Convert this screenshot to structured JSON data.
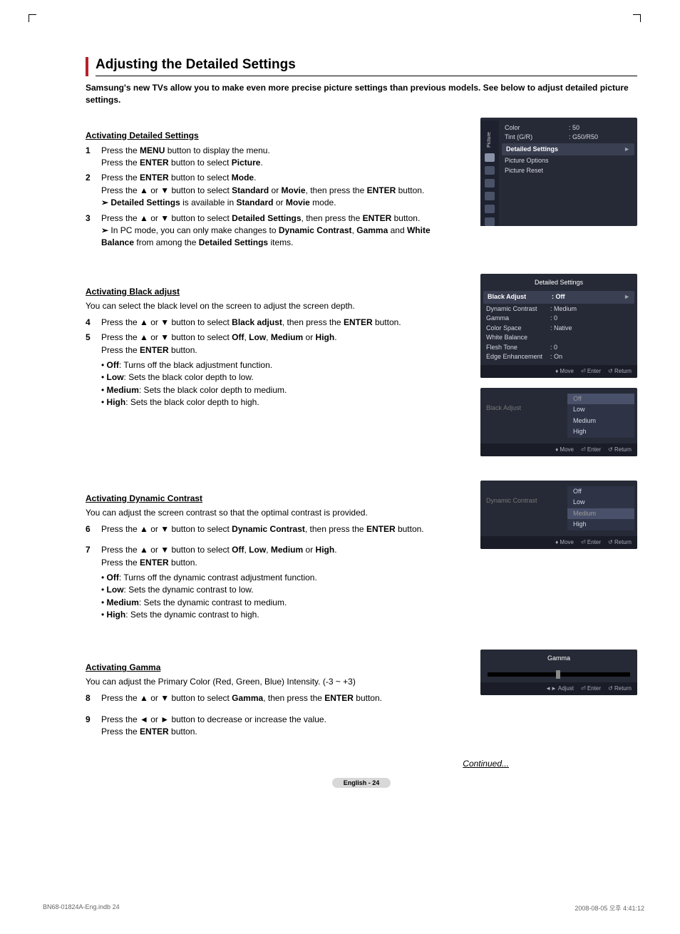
{
  "page": {
    "title": "Adjusting the Detailed Settings",
    "intro": "Samsung's new TVs allow you to make even more precise picture settings than previous models. See below to adjust detailed picture settings.",
    "continued": "Continued...",
    "footer_label": "English - 24",
    "footer_left": "BN68-01824A-Eng.indb   24",
    "footer_right": "2008-08-05   오후 4:41:12"
  },
  "s1": {
    "heading": "Activating Detailed Settings",
    "step1a": "Press the ",
    "step1a_btn": "MENU",
    "step1a_end": " button to display the menu.",
    "step1b": "Press the ",
    "step1b_btn": "ENTER",
    "step1b_end": " button to select ",
    "step1b_item": "Picture",
    "step2a": "Press the ",
    "step2a_btn": "ENTER",
    "step2a_end": " button to select ",
    "step2a_item": "Mode",
    "step2b": "Press the ▲ or ▼ button to select ",
    "step2b_i1": "Standard",
    "step2b_or": " or ",
    "step2b_i2": "Movie",
    "step2b_end": ", then press the ",
    "step2b_btn": "ENTER",
    "step2b_tail": " button.",
    "note2_pre": "Detailed Settings",
    "note2_mid": " is available in ",
    "note2_i1": "Standard",
    "note2_or": " or ",
    "note2_i2": "Movie",
    "note2_end": " mode.",
    "step3a": "Press the ▲ or ▼ button to select ",
    "step3a_item": "Detailed Settings",
    "step3a_end": ", then press the ",
    "step3a_btn": "ENTER",
    "step3a_tail": " button.",
    "note3_pre": "In PC mode, you can only make changes to ",
    "note3_i1": "Dynamic Contrast",
    "note3_c1": ", ",
    "note3_i2": "Gamma",
    "note3_and": " and ",
    "note3_i3": "White Balance",
    "note3_mid": " from among the ",
    "note3_i4": "Detailed Settings",
    "note3_end": " items."
  },
  "osd1": {
    "tab": "Picture",
    "color_l": "Color",
    "color_v": ": 50",
    "tint_l": "Tint (G/R)",
    "tint_v": ": G50/R50",
    "detailed": "Detailed Settings",
    "picopt": "Picture Options",
    "picreset": "Picture Reset"
  },
  "s2": {
    "heading": "Activating Black adjust",
    "desc": "You can select the black level on the screen to adjust the screen depth.",
    "step4": "Press the ▲ or ▼ button to select ",
    "step4_item": "Black adjust",
    "step4_end": ", then press the ",
    "step4_btn": "ENTER",
    "step4_tail": " button.",
    "step5": "Press the ▲ or ▼ button to select ",
    "step5_i1": "Off",
    "step5_c1": ", ",
    "step5_i2": "Low",
    "step5_c2": ", ",
    "step5_i3": "Medium",
    "step5_or": " or ",
    "step5_i4": "High",
    "step5_end": ".",
    "step5b": "Press the ",
    "step5b_btn": "ENTER",
    "step5b_end": " button.",
    "b1a": "Off",
    "b1b": ": Turns off the black adjustment function.",
    "b2a": "Low",
    "b2b": ": Sets the black color depth to low.",
    "b3a": "Medium",
    "b3b": ": Sets the black color depth to medium.",
    "b4a": "High",
    "b4b": ": Sets the black color depth to high."
  },
  "osd2": {
    "title": "Detailed Settings",
    "r1l": "Black Adjust",
    "r1v": ": Off",
    "r2l": "Dynamic Contrast",
    "r2v": ": Medium",
    "r3l": "Gamma",
    "r3v": ": 0",
    "r4l": "Color Space",
    "r4v": ": Native",
    "r5l": "White Balance",
    "r6l": "Flesh Tone",
    "r6v": ": 0",
    "r7l": "Edge Enhancement",
    "r7v": ": On",
    "move": "Move",
    "enter": "Enter",
    "return": "Return"
  },
  "osd3": {
    "label": "Black Adjust",
    "o1": "Off",
    "o2": "Low",
    "o3": "Medium",
    "o4": "High"
  },
  "s3": {
    "heading": "Activating Dynamic Contrast",
    "desc": "You can adjust the screen contrast so that the optimal contrast is provided.",
    "step6": "Press the ▲ or ▼ button to select ",
    "step6_item": "Dynamic Contrast",
    "step6_end": ", then press the ",
    "step6_btn": "ENTER",
    "step6_tail": " button.",
    "step7": "Press the ▲ or ▼ button to select ",
    "step7_i1": "Off",
    "step7_c1": ", ",
    "step7_i2": "Low",
    "step7_c2": ", ",
    "step7_i3": "Medium",
    "step7_or": " or ",
    "step7_i4": "High",
    "step7_end": ".",
    "step7b": "Press the ",
    "step7b_btn": "ENTER",
    "step7b_end": " button.",
    "b1a": "Off",
    "b1b": ": Turns off the dynamic contrast adjustment function.",
    "b2a": "Low",
    "b2b": ": Sets the dynamic contrast to low.",
    "b3a": "Medium",
    "b3b": ": Sets the dynamic contrast to medium.",
    "b4a": "High",
    "b4b": ": Sets the dynamic contrast to high."
  },
  "osd4": {
    "label": "Dynamic Contrast",
    "o1": "Off",
    "o2": "Low",
    "o3": "Medium",
    "o4": "High"
  },
  "s4": {
    "heading": "Activating Gamma",
    "desc": "You can adjust the Primary Color (Red, Green, Blue) Intensity. (-3 ~ +3)",
    "step8": "Press the ▲ or ▼ button to select ",
    "step8_item": "Gamma",
    "step8_end": ", then press the ",
    "step8_btn": "ENTER",
    "step8_tail": " button.",
    "step9": "Press the ◄ or ► button to decrease or increase the value.",
    "step9b": "Press the ",
    "step9b_btn": "ENTER",
    "step9b_end": " button."
  },
  "osd5": {
    "title": "Gamma",
    "value": "0",
    "adjust": "Adjust",
    "enter": "Enter",
    "return": "Return"
  }
}
